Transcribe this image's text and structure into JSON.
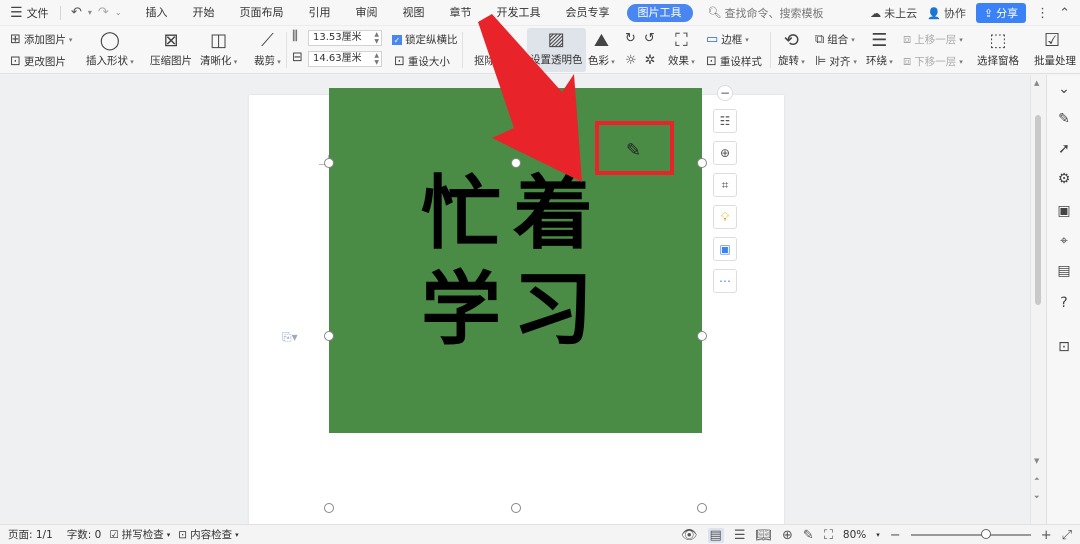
{
  "menubar": {
    "file_label": "文件",
    "tabs": [
      {
        "label": "插入"
      },
      {
        "label": "开始"
      },
      {
        "label": "页面布局"
      },
      {
        "label": "引用"
      },
      {
        "label": "审阅"
      },
      {
        "label": "视图"
      },
      {
        "label": "章节"
      },
      {
        "label": "开发工具"
      },
      {
        "label": "会员专享"
      },
      {
        "label": "图片工具",
        "active": true
      }
    ],
    "search_placeholder": "查找命令、搜索模板",
    "cloud_label": "未上云",
    "collab_label": "协作",
    "share_label": "分享"
  },
  "ribbon": {
    "add_picture": "添加图片",
    "change_picture": "更改图片",
    "insert_shape": "插入形状",
    "compress_picture": "压缩图片",
    "sharpen": "清晰化",
    "crop": "裁剪",
    "height_value": "13.53厘米",
    "width_value": "14.63厘米",
    "lock_ratio": "锁定纵横比",
    "reset_size": "重设大小",
    "remove_background": "抠除背景",
    "set_transparent": "设置透明色",
    "color": "色彩",
    "effects": "效果",
    "border": "边框",
    "reset_style": "重设样式",
    "rotate": "旋转",
    "group": "组合",
    "align": "对齐",
    "wrap": "环绕",
    "bring_forward": "上移一层",
    "send_backward": "下移一层",
    "selection_pane": "选择窗格",
    "batch_process": "批量处理"
  },
  "image": {
    "line1": "忙着",
    "line2": "学习",
    "bg_color": "#4a8b46"
  },
  "float_tools": [
    "layout-options-icon",
    "zoom-in-icon",
    "crop-icon",
    "lightbulb-icon",
    "image-to-text-icon",
    "more-icon"
  ],
  "status": {
    "page": "页面: 1/1",
    "word_count": "字数: 0",
    "spell_check": "拼写检查",
    "content_check": "内容检查",
    "zoom": "80%"
  },
  "colors": {
    "accent": "#4a86f2",
    "annotation_red": "#e8232a"
  }
}
